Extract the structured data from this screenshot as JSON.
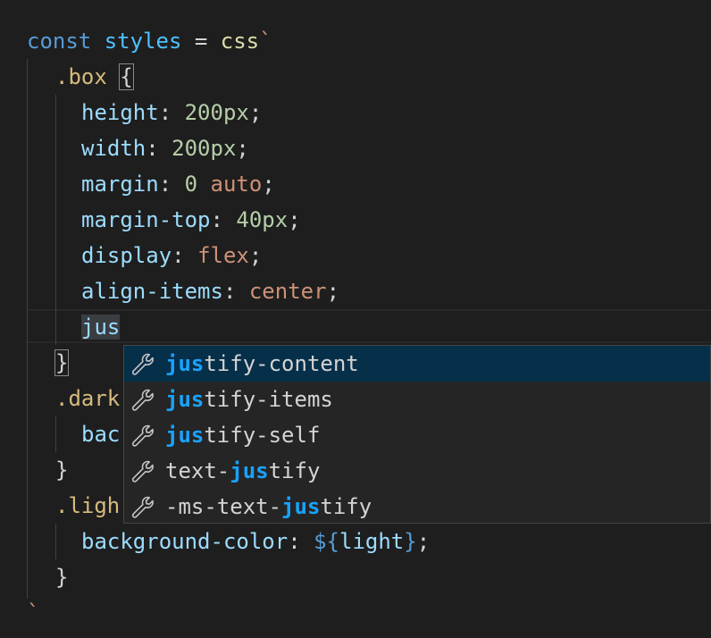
{
  "editor": {
    "lines": [
      {
        "tokens": [
          [
            "kw",
            "const "
          ],
          [
            "var",
            "styles"
          ],
          [
            "op",
            " = "
          ],
          [
            "fn",
            "css"
          ],
          [
            "str",
            "`"
          ]
        ]
      },
      {
        "tokens": [
          [
            "sel",
            ".box "
          ],
          [
            "punc",
            "{"
          ]
        ]
      },
      {
        "tokens": [
          [
            "prop",
            "height"
          ],
          [
            "punc",
            ": "
          ],
          [
            "num",
            "200px"
          ],
          [
            "punc",
            ";"
          ]
        ]
      },
      {
        "tokens": [
          [
            "prop",
            "width"
          ],
          [
            "punc",
            ": "
          ],
          [
            "num",
            "200px"
          ],
          [
            "punc",
            ";"
          ]
        ]
      },
      {
        "tokens": [
          [
            "prop",
            "margin"
          ],
          [
            "punc",
            ": "
          ],
          [
            "num",
            "0 "
          ],
          [
            "val",
            "auto"
          ],
          [
            "punc",
            ";"
          ]
        ]
      },
      {
        "tokens": [
          [
            "prop",
            "margin-top"
          ],
          [
            "punc",
            ": "
          ],
          [
            "num",
            "40px"
          ],
          [
            "punc",
            ";"
          ]
        ]
      },
      {
        "tokens": [
          [
            "prop",
            "display"
          ],
          [
            "punc",
            ": "
          ],
          [
            "val",
            "flex"
          ],
          [
            "punc",
            ";"
          ]
        ]
      },
      {
        "tokens": [
          [
            "prop",
            "align-items"
          ],
          [
            "punc",
            ": "
          ],
          [
            "val",
            "center"
          ],
          [
            "punc",
            ";"
          ]
        ]
      },
      {
        "tokens": [
          [
            "prop",
            "jus"
          ]
        ]
      },
      {
        "tokens": [
          [
            "punc",
            "}"
          ]
        ]
      },
      {
        "tokens": [
          [
            "sel",
            ".dark"
          ]
        ]
      },
      {
        "tokens": [
          [
            "prop",
            "bac"
          ]
        ]
      },
      {
        "tokens": [
          [
            "punc",
            "}"
          ]
        ]
      },
      {
        "tokens": [
          [
            "sel",
            ".ligh"
          ]
        ]
      },
      {
        "tokens": [
          [
            "prop",
            "background-color"
          ],
          [
            "punc",
            ": "
          ],
          [
            "tpl",
            "${"
          ],
          [
            "prop",
            "light"
          ],
          [
            "tpl",
            "}"
          ],
          [
            "punc",
            ";"
          ]
        ]
      },
      {
        "tokens": [
          [
            "punc",
            "}"
          ]
        ]
      },
      {
        "tokens": [
          [
            "str",
            "`"
          ]
        ]
      }
    ]
  },
  "suggestions": [
    {
      "pre": "",
      "match": "jus",
      "post": "tify-content",
      "icon": "wrench-icon",
      "selected": true
    },
    {
      "pre": "",
      "match": "jus",
      "post": "tify-items",
      "icon": "wrench-icon",
      "selected": false
    },
    {
      "pre": "",
      "match": "jus",
      "post": "tify-self",
      "icon": "wrench-icon",
      "selected": false
    },
    {
      "pre": "text-",
      "match": "jus",
      "post": "tify",
      "icon": "wrench-icon",
      "selected": false
    },
    {
      "pre": "-ms-text-",
      "match": "jus",
      "post": "tify",
      "icon": "wrench-icon",
      "selected": false
    }
  ],
  "colors": {
    "background": "#1e1e1e",
    "suggest_bg": "#252526",
    "suggest_selected": "#062f4a",
    "match_highlight": "#18a3ff"
  }
}
